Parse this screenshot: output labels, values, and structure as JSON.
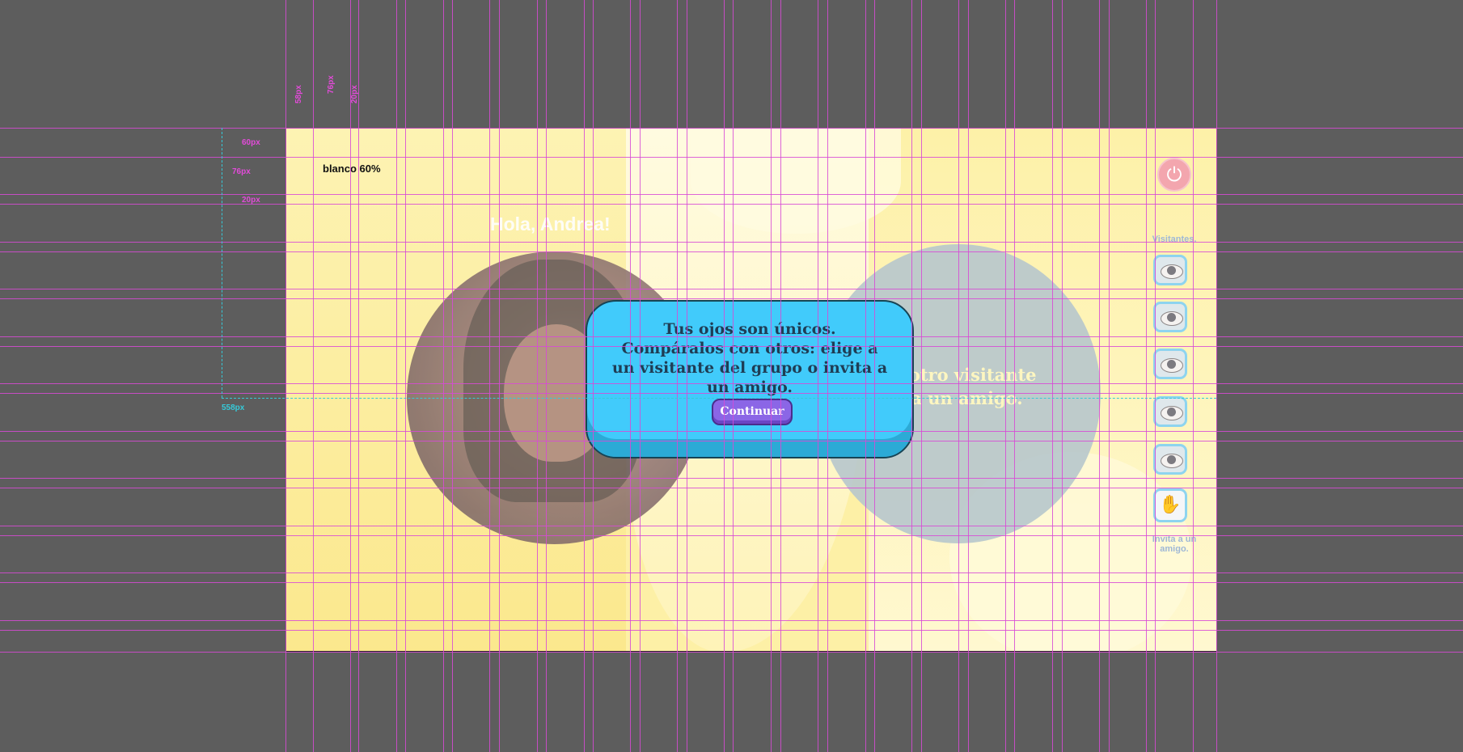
{
  "app": {
    "page_note": "blanco 60%",
    "greeting": "Hola, Andrea!",
    "compare_text": "de otro visitante\na a un amigo.",
    "sidebar": {
      "visitors_label": "Visitantes.",
      "invite_label": "Invita a un amigo.",
      "visitor_count": 5
    },
    "power_icon": "power-icon",
    "invite_icon": "hand-icon"
  },
  "dialog": {
    "text": "Tus ojos son únicos. Compáralos con otros: elige a un visitante del grupo o invita a un amigo.",
    "button_label": "Continuar"
  },
  "annotations": {
    "top_dims": [
      "58px",
      "76px",
      "20px"
    ],
    "left_dims": [
      "60px",
      "76px",
      "20px"
    ],
    "cyan_dim": "558px"
  },
  "colors": {
    "dialog_bg": "#41cbfb",
    "button_bg": "#8b66e6",
    "guide": "#d84ad6",
    "artboard_bg": "#fdf0a6"
  }
}
